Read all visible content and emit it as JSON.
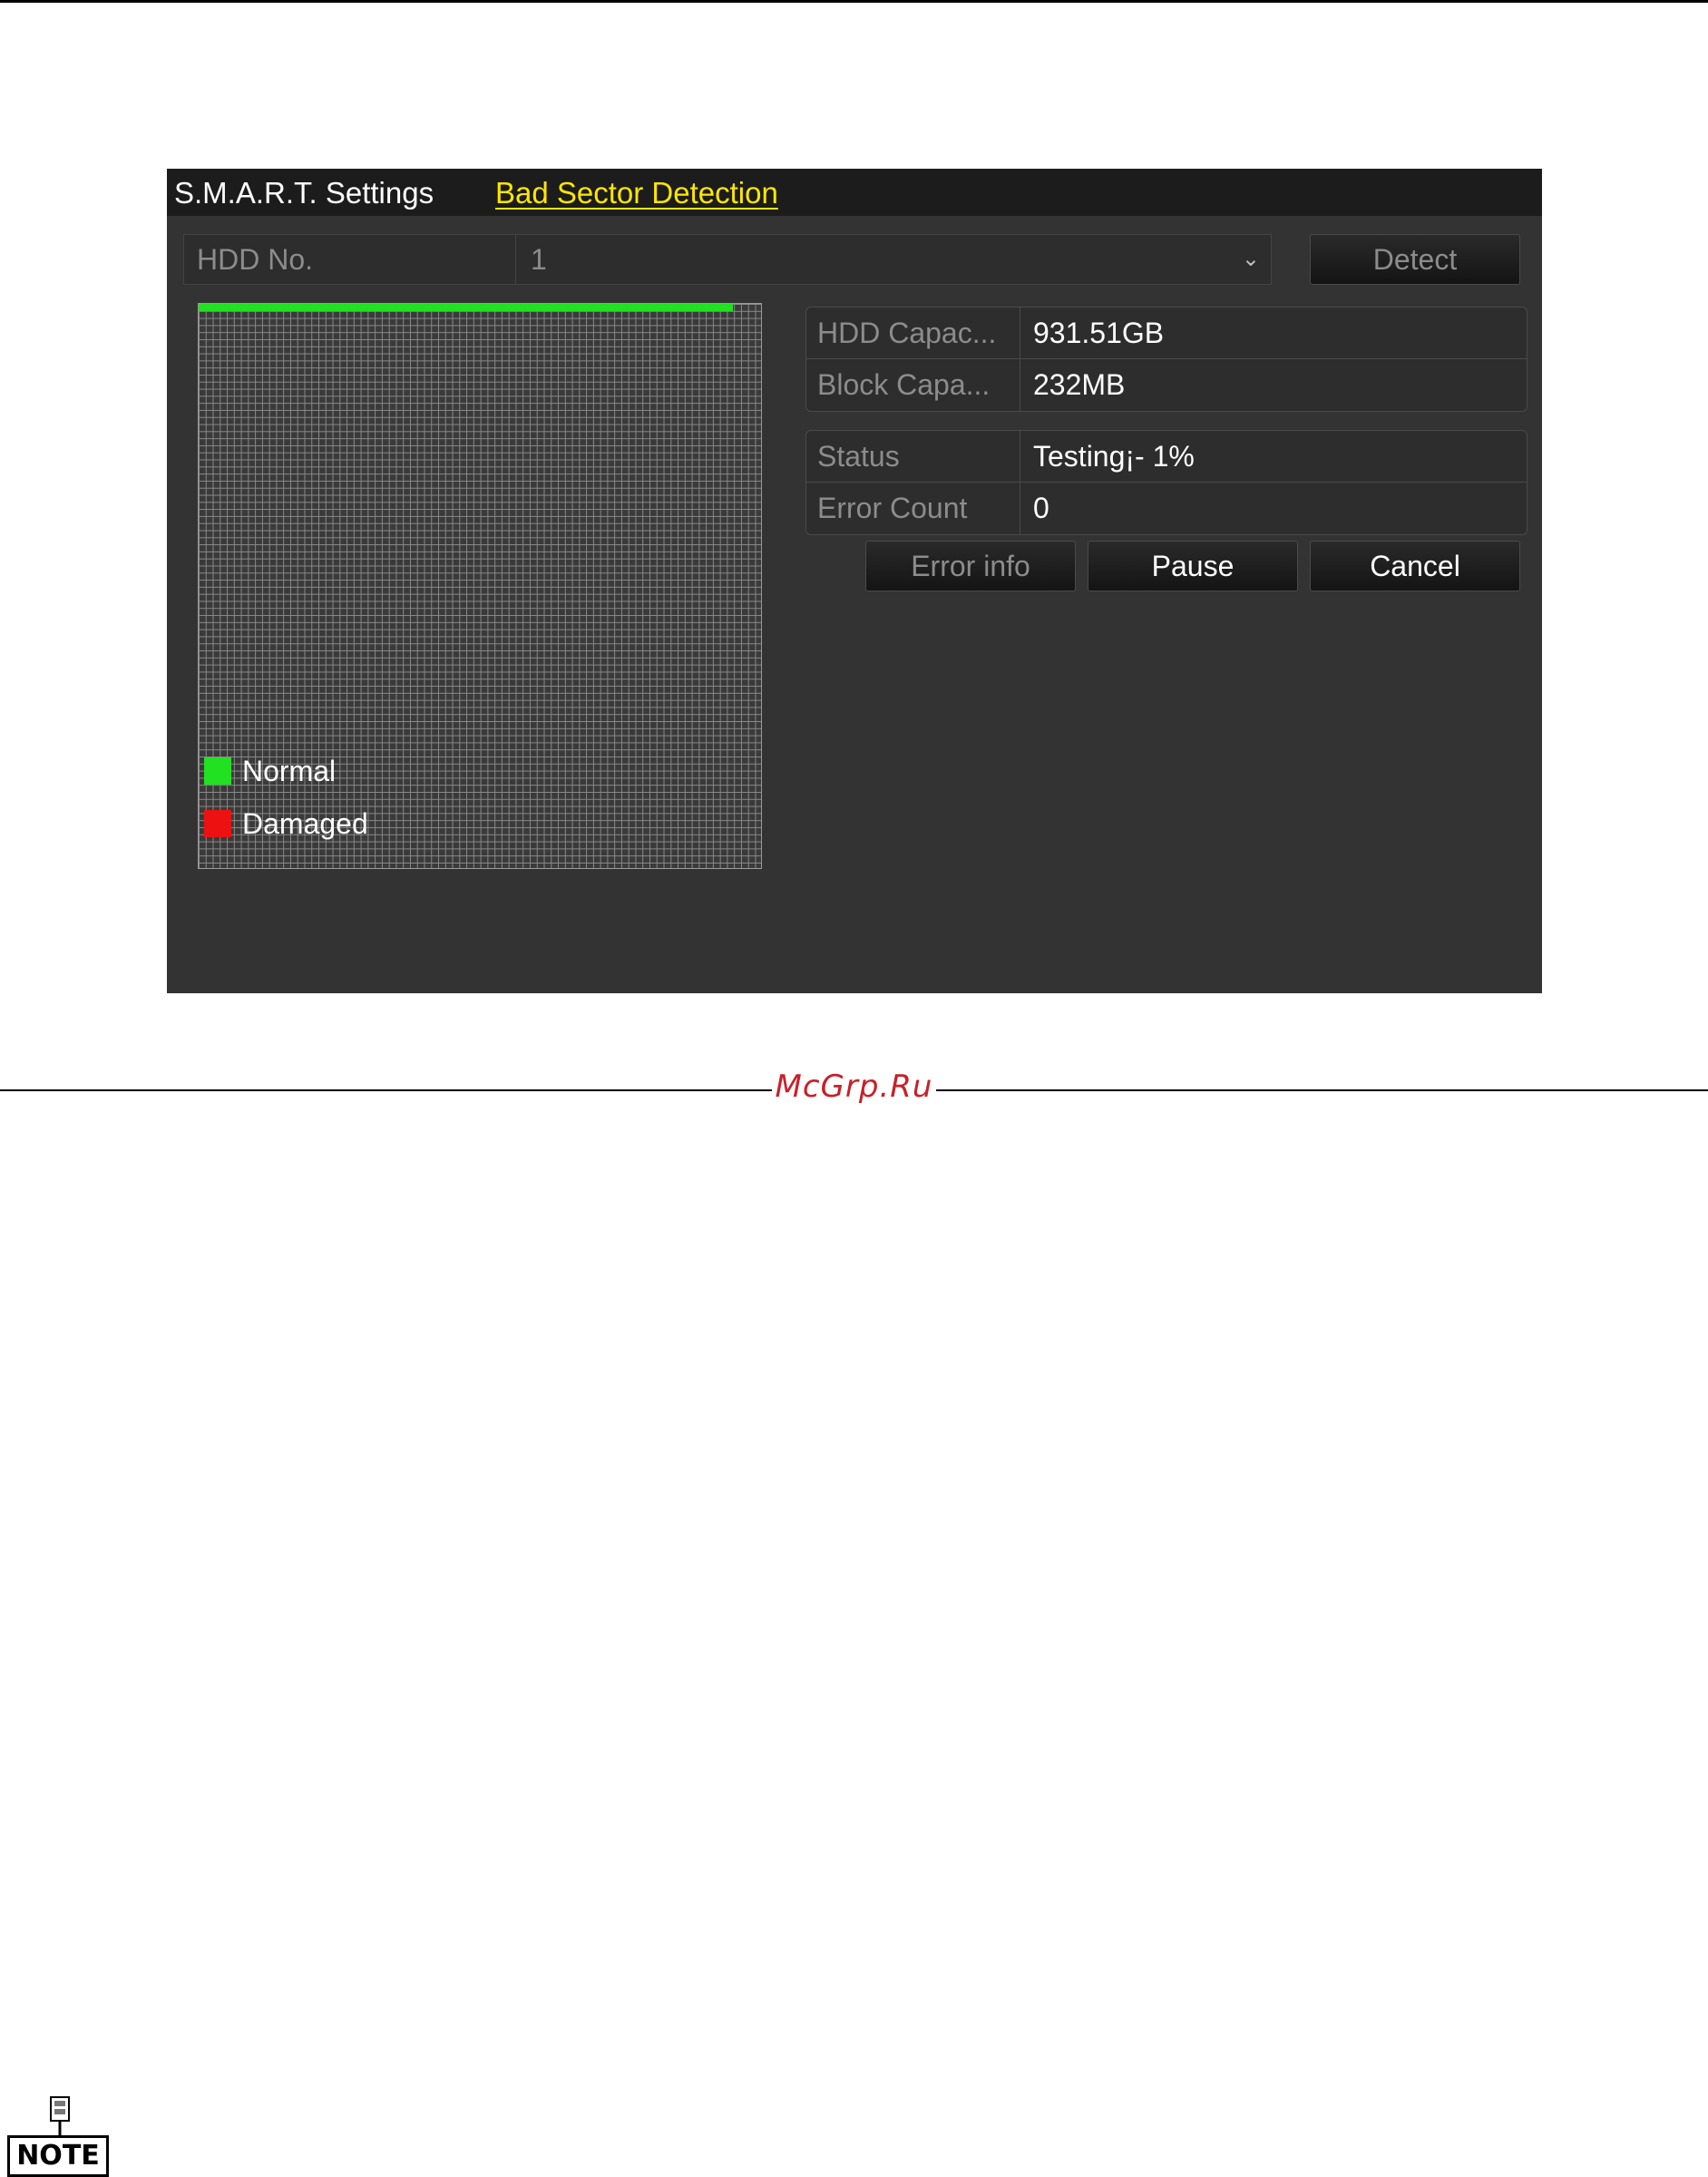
{
  "tabs": [
    {
      "label": "S.M.A.R.T. Settings",
      "active": false
    },
    {
      "label": "Bad Sector Detection",
      "active": true
    }
  ],
  "hdd": {
    "label": "HDD No.",
    "value": "1"
  },
  "buttons": {
    "detect": "Detect",
    "error_info": "Error info",
    "pause": "Pause",
    "cancel": "Cancel"
  },
  "info": {
    "hdd_capacity": {
      "label": "HDD Capac...",
      "value": "931.51GB"
    },
    "block_capacity": {
      "label": "Block Capa...",
      "value": "232MB"
    },
    "status": {
      "label": "Status",
      "value": "Testing¡- 1%"
    },
    "error_count": {
      "label": "Error Count",
      "value": "0"
    }
  },
  "scan_progress_fraction": 0.95,
  "legend": [
    {
      "label": "Normal",
      "color": "#22e022"
    },
    {
      "label": "Damaged",
      "color": "#ee1111"
    }
  ],
  "colors": {
    "accent_tab": "#ffe600",
    "panel_bg": "#333333",
    "normal": "#22e022",
    "damaged": "#ee1111"
  },
  "watermark": "McGrp.Ru",
  "note_label": "NOTE"
}
